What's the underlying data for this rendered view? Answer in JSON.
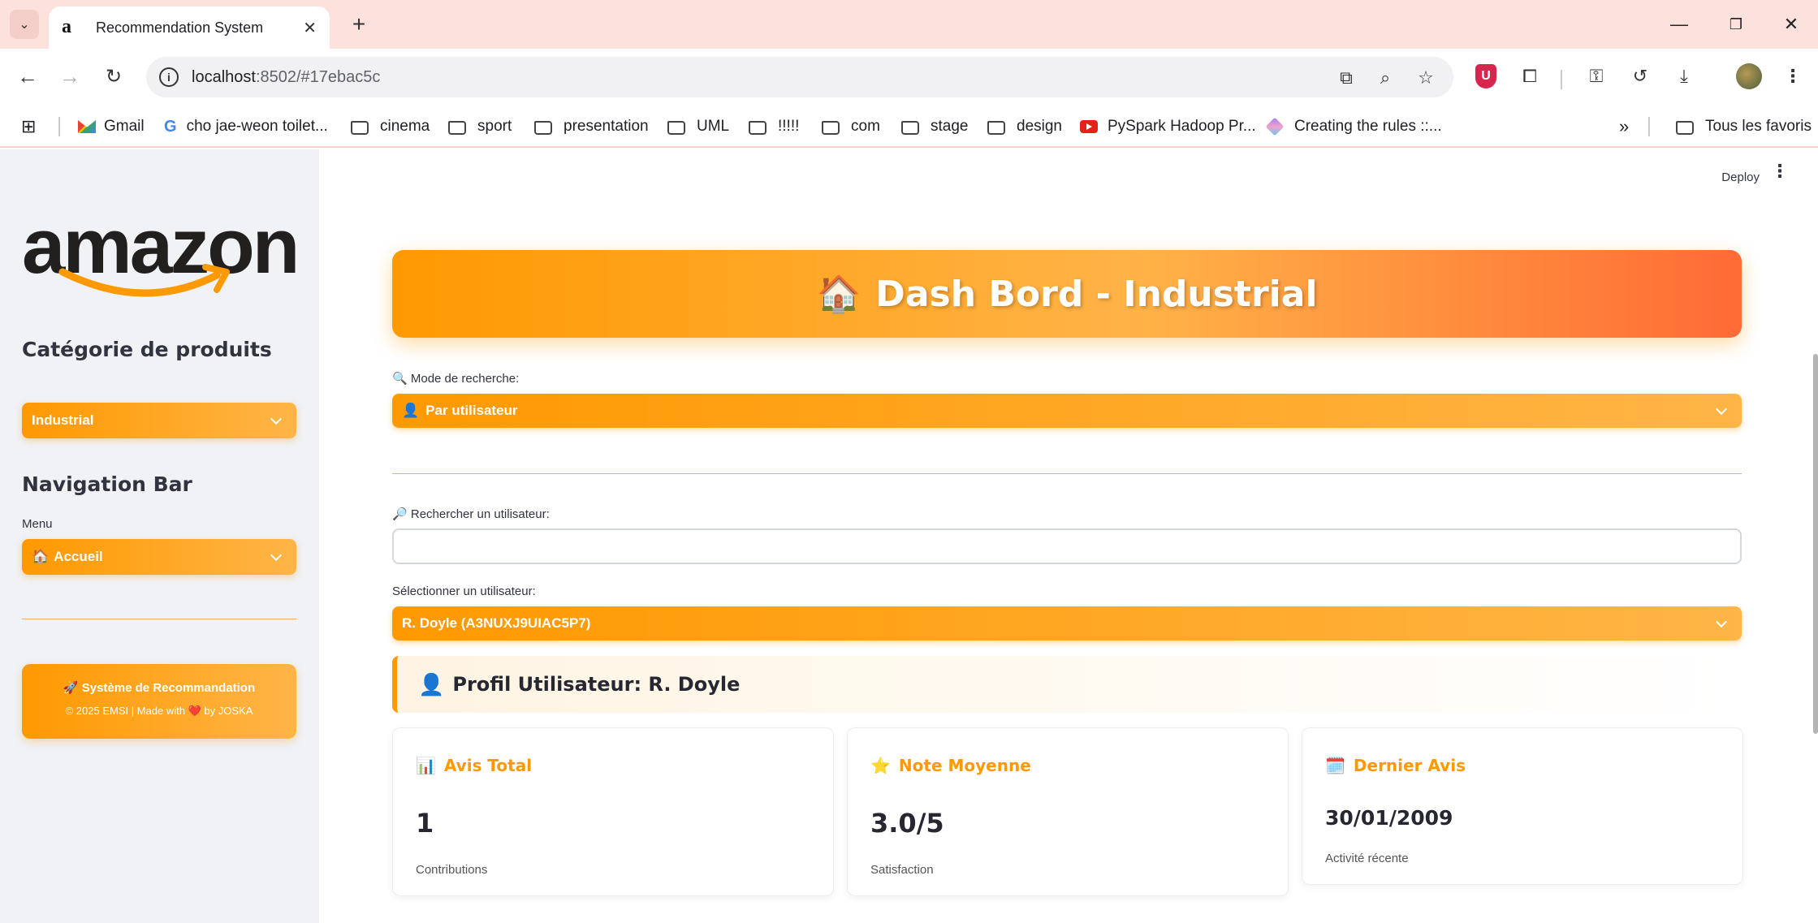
{
  "browser": {
    "tab_title": "Recommendation System",
    "tab_favicon": "a",
    "url_host": "localhost",
    "url_rest": ":8502/#17ebac5c",
    "bookmarks": [
      "Gmail",
      "cho jae-weon toilet...",
      "cinema",
      "sport",
      "presentation",
      "UML",
      "!!!!!",
      "com",
      "stage",
      "design",
      "PySpark Hadoop Pr...",
      "Creating the rules ::..."
    ],
    "all_bookmarks": "Tous les favoris"
  },
  "sidebar": {
    "logo": "amazon",
    "category_heading": "Catégorie de produits",
    "category_value": "Industrial",
    "nav_heading": "Navigation Bar",
    "menu_label": "Menu",
    "menu_icon": "🏠",
    "menu_value": "Accueil",
    "footer_icon": "🚀",
    "footer_title": "Système de Recommandation",
    "footer_line_a": "© 2025 EMSI | Made with",
    "footer_heart": "❤️",
    "footer_line_b": "by JOSKA"
  },
  "header": {
    "deploy": "Deploy",
    "menu_icon": "⋮"
  },
  "main": {
    "hero_icon": "🏠",
    "hero_title": "Dash Bord - Industrial",
    "search_mode_icon": "🔍",
    "search_mode_label": "Mode de recherche:",
    "search_mode_value_icon": "👤",
    "search_mode_value": "Par utilisateur",
    "search_user_icon": "🔎",
    "search_user_label": "Rechercher un utilisateur:",
    "search_user_value": "",
    "select_user_label": "Sélectionner un utilisateur:",
    "select_user_value": "R. Doyle (A3NUXJ9UIAC5P7)",
    "profile_icon": "👤",
    "profile_title": "Profil Utilisateur: R. Doyle",
    "cards": [
      {
        "icon": "📊",
        "title": "Avis Total",
        "value": "1",
        "sub": "Contributions"
      },
      {
        "icon": "⭐",
        "title": "Note Moyenne",
        "value": "3.0/5",
        "sub": "Satisfaction"
      },
      {
        "icon": "🗓️",
        "title": "Dernier Avis",
        "value": "30/01/2009",
        "sub": "Activité récente"
      }
    ]
  },
  "colors": {
    "accent": "#ff9900",
    "accent_end": "#ff6b35",
    "sidebar_bg": "#f0f2f6"
  }
}
